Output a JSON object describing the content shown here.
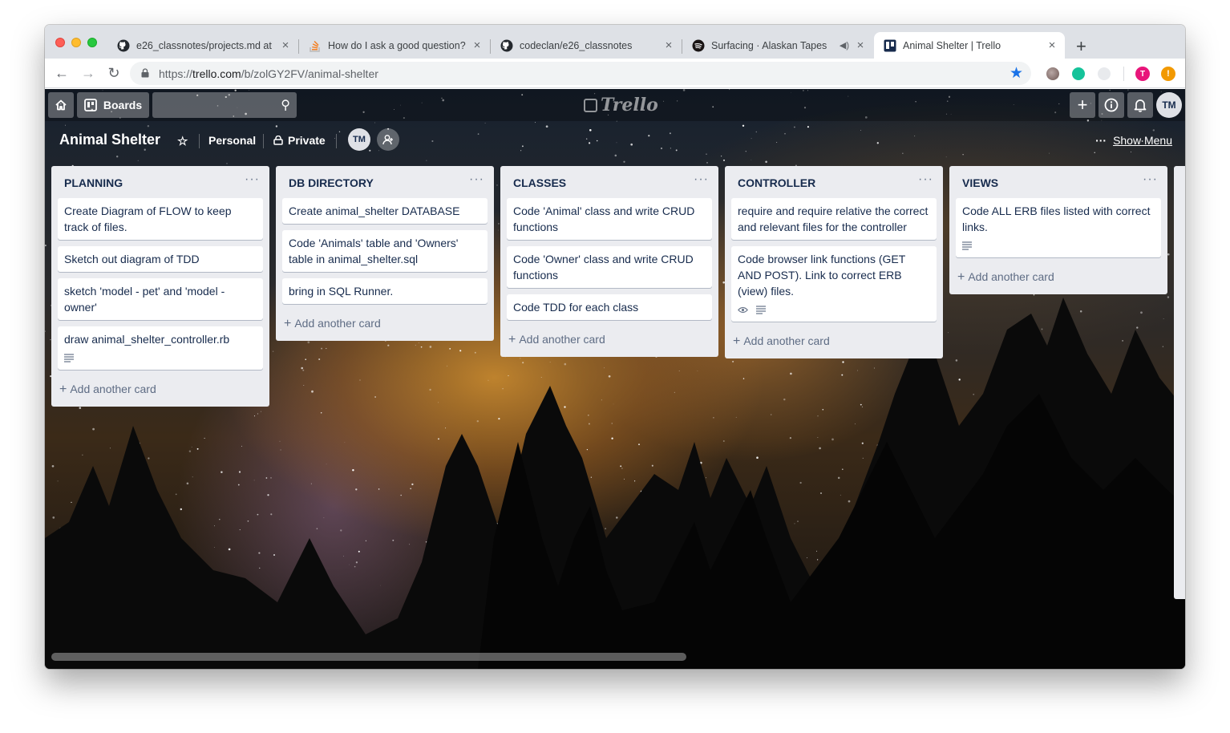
{
  "browser": {
    "tabs": [
      {
        "title": "e26_classnotes/projects.md at",
        "icon": "github-icon"
      },
      {
        "title": "How do I ask a good question?",
        "icon": "stackoverflow-icon"
      },
      {
        "title": "codeclan/e26_classnotes",
        "icon": "github-icon"
      },
      {
        "title": "Surfacing · Alaskan Tapes",
        "icon": "spotify-icon"
      },
      {
        "title": "Animal Shelter | Trello",
        "icon": "trello-icon"
      }
    ],
    "url_prefix": "https://",
    "url_host": "trello.com",
    "url_path": "/b/zolGY2FV/animal-shelter"
  },
  "trello": {
    "boards_label": "Boards",
    "logo_text": "Trello",
    "avatar_initials": "TM",
    "board_title": "Animal Shelter",
    "team_label": "Personal",
    "visibility_label": "Private",
    "show_menu_label": "Show Menu",
    "lists": [
      {
        "title": "PLANNING",
        "cards": [
          {
            "text": "Create Diagram of FLOW to keep track of files."
          },
          {
            "text": "Sketch out diagram of TDD"
          },
          {
            "text": "sketch 'model - pet' and 'model - owner'"
          },
          {
            "text": "draw animal_shelter_controller.rb"
          }
        ],
        "add_label": "Add another card"
      },
      {
        "title": "DB DIRECTORY",
        "cards": [
          {
            "text": "Create animal_shelter DATABASE"
          },
          {
            "text": "Code 'Animals' table and 'Owners' table in animal_shelter.sql"
          },
          {
            "text": "bring in SQL Runner."
          }
        ],
        "add_label": "Add another card"
      },
      {
        "title": "CLASSES",
        "cards": [
          {
            "text": "Code 'Animal' class and write CRUD functions"
          },
          {
            "text": "Code 'Owner' class and write CRUD functions"
          },
          {
            "text": "Code TDD for each class"
          }
        ],
        "add_label": "Add another card"
      },
      {
        "title": "CONTROLLER",
        "cards": [
          {
            "text": "require and require relative the correct and relevant files for the controller"
          },
          {
            "text": "Code browser link functions (GET AND POST). Link to correct ERB (view) files."
          }
        ],
        "add_label": "Add another card"
      },
      {
        "title": "VIEWS",
        "cards": [
          {
            "text": "Code ALL ERB files listed with correct links."
          }
        ],
        "add_label": "Add another card"
      }
    ]
  }
}
